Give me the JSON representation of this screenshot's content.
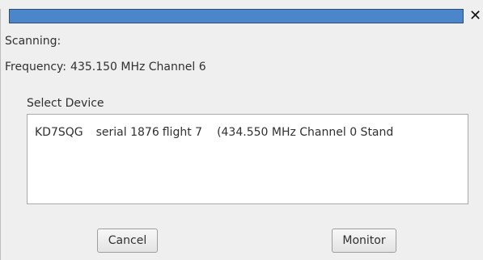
{
  "window": {
    "close_glyph": "✕"
  },
  "status": {
    "scanning_label": "Scanning:",
    "frequency_label": "Frequency:",
    "frequency_value": "435.150 MHz Channel 6"
  },
  "devices": {
    "group_title": "Select Device",
    "items": [
      {
        "callsign": "KD7SQG",
        "serial": "serial 1876",
        "flight": "flight 7",
        "detail": "(434.550 MHz Channel 0 Stand"
      }
    ]
  },
  "buttons": {
    "cancel_label": "Cancel",
    "monitor_label": "Monitor"
  },
  "colors": {
    "titlebar": "#4a86c9",
    "window_bg": "#efefef",
    "list_bg": "#ffffff"
  }
}
